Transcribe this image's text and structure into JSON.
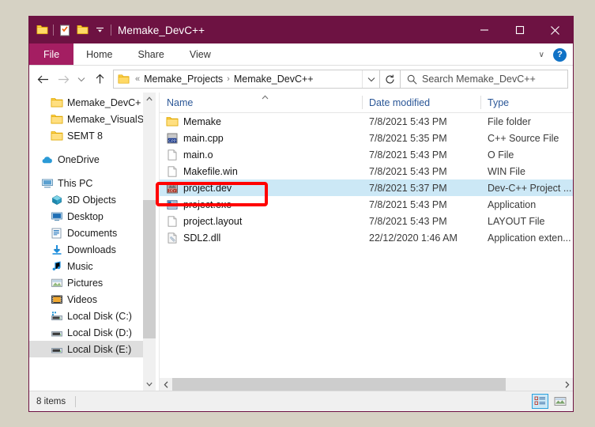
{
  "window": {
    "title": "Memake_DevC++",
    "accent_color": "#6d1242",
    "file_tab_color": "#a41e62",
    "minimize_label": "—",
    "maximize_label": "☐",
    "close_label": "✕",
    "quick_access": [
      {
        "name": "folder-icon",
        "label": ""
      },
      {
        "name": "properties-icon",
        "label": ""
      },
      {
        "name": "new-folder-icon",
        "label": ""
      },
      {
        "name": "customize-qat-dropdown-icon",
        "label": ""
      }
    ]
  },
  "ribbon": {
    "file_tab": "File",
    "tabs": [
      "Home",
      "Share",
      "View"
    ],
    "collapse_icon": "∨",
    "help_label": "?"
  },
  "nav": {
    "back_icon": "←",
    "forward_icon": "→",
    "recent_icon": "∨",
    "up_icon": "↑",
    "overflow": "«",
    "crumbs": [
      "Memake_Projects",
      "Memake_DevC++"
    ],
    "crumb_sep": "›",
    "address_dropdown_icon": "∨",
    "refresh_icon": "↻",
    "search_placeholder": "Search Memake_DevC++"
  },
  "sidebar": {
    "items": [
      {
        "label": "Memake_DevC+",
        "icon": "folder-icon",
        "level": 2,
        "gap_before": false
      },
      {
        "label": "Memake_VisualS",
        "icon": "folder-icon",
        "level": 2,
        "gap_before": false
      },
      {
        "label": "SEMT 8",
        "icon": "folder-icon",
        "level": 2,
        "gap_before": false
      },
      {
        "label": "OneDrive",
        "icon": "onedrive-icon",
        "level": 1,
        "gap_before": true
      },
      {
        "label": "This PC",
        "icon": "this-pc-icon",
        "level": 1,
        "gap_before": true
      },
      {
        "label": "3D Objects",
        "icon": "3d-objects-icon",
        "level": 2,
        "gap_before": false
      },
      {
        "label": "Desktop",
        "icon": "desktop-icon",
        "level": 2,
        "gap_before": false
      },
      {
        "label": "Documents",
        "icon": "documents-icon",
        "level": 2,
        "gap_before": false
      },
      {
        "label": "Downloads",
        "icon": "downloads-icon",
        "level": 2,
        "gap_before": false
      },
      {
        "label": "Music",
        "icon": "music-icon",
        "level": 2,
        "gap_before": false
      },
      {
        "label": "Pictures",
        "icon": "pictures-icon",
        "level": 2,
        "gap_before": false
      },
      {
        "label": "Videos",
        "icon": "videos-icon",
        "level": 2,
        "gap_before": false
      },
      {
        "label": "Local Disk (C:)",
        "icon": "system-drive-icon",
        "level": 2,
        "gap_before": false
      },
      {
        "label": "Local Disk (D:)",
        "icon": "drive-icon",
        "level": 2,
        "gap_before": false
      },
      {
        "label": "Local Disk (E:)",
        "icon": "drive-icon",
        "level": 2,
        "gap_before": false,
        "selected": true
      }
    ],
    "scroll_up_icon": "∧",
    "scroll_down_icon": "∨"
  },
  "filelist": {
    "columns": [
      "Name",
      "Date modified",
      "Type"
    ],
    "sort_arrow": "∧",
    "rows": [
      {
        "name": "Memake",
        "date": "7/8/2021 5:43 PM",
        "type": "File folder",
        "icon": "folder-icon",
        "selected": false
      },
      {
        "name": "main.cpp",
        "date": "7/8/2021 5:35 PM",
        "type": "C++ Source File",
        "icon": "cpp-file-icon",
        "selected": false
      },
      {
        "name": "main.o",
        "date": "7/8/2021 5:43 PM",
        "type": "O File",
        "icon": "blank-file-icon",
        "selected": false
      },
      {
        "name": "Makefile.win",
        "date": "7/8/2021 5:43 PM",
        "type": "WIN File",
        "icon": "blank-file-icon",
        "selected": false
      },
      {
        "name": "project.dev",
        "date": "7/8/2021 5:37 PM",
        "type": "Dev-C++ Project ...",
        "icon": "devcpp-file-icon",
        "selected": true
      },
      {
        "name": "project.exe",
        "date": "7/8/2021 5:43 PM",
        "type": "Application",
        "icon": "exe-file-icon",
        "selected": false
      },
      {
        "name": "project.layout",
        "date": "7/8/2021 5:43 PM",
        "type": "LAYOUT File",
        "icon": "blank-file-icon",
        "selected": false
      },
      {
        "name": "SDL2.dll",
        "date": "22/12/2020 1:46 AM",
        "type": "Application exten...",
        "icon": "dll-file-icon",
        "selected": false
      }
    ],
    "hscroll_left_icon": "‹",
    "hscroll_right_icon": "›"
  },
  "statusbar": {
    "item_count": "8 items",
    "details_view_name": "details-view-button",
    "large_icons_view_name": "large-icons-view-button"
  },
  "annotation": {
    "color": "#ff0000",
    "target": "project.dev"
  }
}
